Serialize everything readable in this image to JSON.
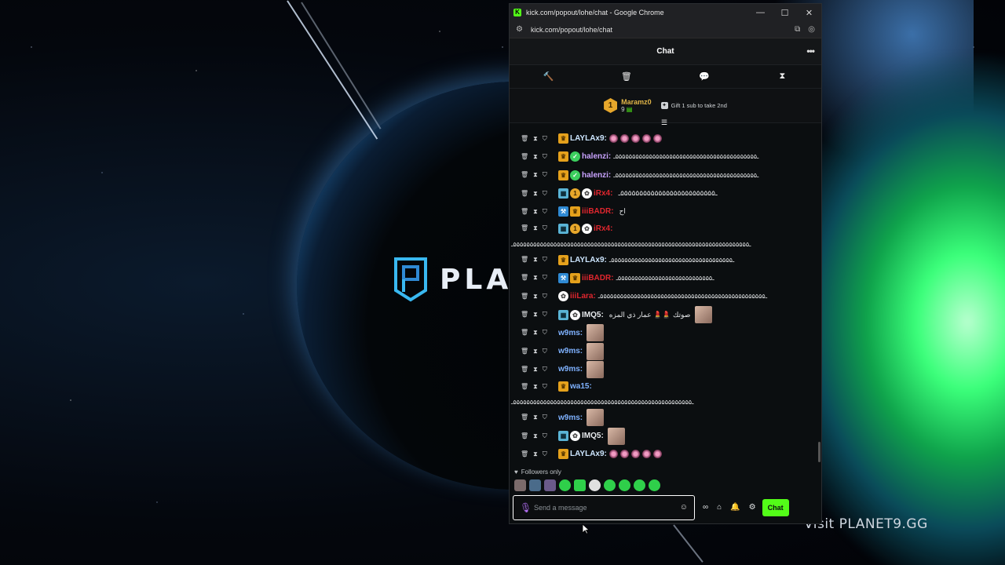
{
  "background": {
    "logo_text": "PLA",
    "visit_text": "Visit PLANET9.GG"
  },
  "window": {
    "title": "kick.com/popout/lohe/chat - Google Chrome",
    "url": "kick.com/popout/lohe/chat",
    "controls": {
      "minimize": "—",
      "maximize": "☐",
      "close": "✕"
    }
  },
  "chat": {
    "header_title": "Chat",
    "more_label": "•••",
    "modbar": {
      "ban": "🔨",
      "clear": "🗑",
      "chat_mode": "💬",
      "slow_mode": "⧗"
    },
    "pinned": {
      "rank": "1",
      "username": "Maramz0",
      "count": "9",
      "gift_text": "Gift 1 sub to take 2nd"
    },
    "messages": [
      {
        "user": "LAYLAx9",
        "color": "#cde6ff",
        "badges": [
          "crown"
        ],
        "text": "",
        "emotes": 5
      },
      {
        "user": "halenzi",
        "color": "#c9a3ff",
        "badges": [
          "crown",
          "verified"
        ],
        "text": "ـ۵۵۵۵۵۵۵۵۵۵۵۵۵۵۵۵۵۵۵۵۵۵۵۵۵۵۵۵۵۵۵۵۵۵۵۵۵۵۵۵۵۵ـ"
      },
      {
        "user": "halenzi",
        "color": "#c9a3ff",
        "badges": [
          "crown",
          "verified"
        ],
        "text": "ـ۵۵۵۵۵۵۵۵۵۵۵۵۵۵۵۵۵۵۵۵۵۵۵۵۵۵۵۵۵۵۵۵۵۵۵۵۵۵۵۵۵۵ـ"
      },
      {
        "user": "iRx4",
        "color": "#e0262e",
        "badges": [
          "blue",
          "one",
          "flower"
        ],
        "text": "ـ۵۵۵۵۵۵۵۵۵۵۵۵۵۵۵۵۵۵۵۵۵۵۵۵۵ـ"
      },
      {
        "user": "iiiBADR",
        "color": "#e0262e",
        "badges": [
          "tool",
          "crown"
        ],
        "text": "اح"
      },
      {
        "user": "iRx4",
        "color": "#e0262e",
        "badges": [
          "blue",
          "one",
          "flower"
        ],
        "text": "",
        "cont": "ـ۵۵۵۵۵۵۵۵۵۵۵۵۵۵۵۵۵۵۵۵۵۵۵۵۵۵۵۵۵۵۵۵۵۵۵۵۵۵۵۵۵۵۵۵۵۵۵۵۵۵۵۵۵۵۵۵۵۵۵۵۵۵۵۵۵۵۵۵۵۵ـ"
      },
      {
        "user": "LAYLAx9",
        "color": "#cde6ff",
        "badges": [
          "crown"
        ],
        "text": "ـ۵۵۵۵۵۵۵۵۵۵۵۵۵۵۵۵۵۵۵۵۵۵۵۵۵۵۵۵۵۵۵۵۵۵۵۵ـ"
      },
      {
        "user": "iiiBADR",
        "color": "#e0262e",
        "badges": [
          "tool",
          "crown"
        ],
        "text": "ـ۵۵۵۵۵۵۵۵۵۵۵۵۵۵۵۵۵۵۵۵۵۵۵۵۵۵۵۵ـ"
      },
      {
        "user": "iiiLara",
        "color": "#e0262e",
        "badges": [
          "flower"
        ],
        "text": "ـ۵۵۵۵۵۵۵۵۵۵۵۵۵۵۵۵۵۵۵۵۵۵۵۵۵۵۵۵۵۵۵۵۵۵۵۵۵۵۵۵۵۵۵۵۵۵۵۵۵ـ"
      },
      {
        "user": "IMQ5",
        "color": "#e9ecef",
        "badges": [
          "blue",
          "flower"
        ],
        "text": "صوتك 💄💄 عمار ذي المزه",
        "photo": true
      },
      {
        "user": "w9ms",
        "color": "#7fb2ff",
        "badges": [],
        "text": "",
        "photo": true
      },
      {
        "user": "w9ms",
        "color": "#7fb2ff",
        "badges": [],
        "text": "",
        "photo": true
      },
      {
        "user": "w9ms",
        "color": "#7fb2ff",
        "badges": [],
        "text": "",
        "photo": true
      },
      {
        "user": "wa15",
        "color": "#7fb2ff",
        "badges": [
          "crown"
        ],
        "text": "",
        "cont": "ـ۵۵۵۵۵۵۵۵۵۵۵۵۵۵۵۵۵۵۵۵۵۵۵۵۵۵۵۵۵۵۵۵۵۵۵۵۵۵۵۵۵۵۵۵۵۵۵۵۵۵۵۵۵ـ"
      },
      {
        "user": "w9ms",
        "color": "#7fb2ff",
        "badges": [],
        "text": "",
        "photo": true
      },
      {
        "user": "IMQ5",
        "color": "#e9ecef",
        "badges": [
          "blue",
          "flower"
        ],
        "text": "",
        "photo": true
      },
      {
        "user": "LAYLAx9",
        "color": "#cde6ff",
        "badges": [
          "crown"
        ],
        "text": "",
        "emotes": 5
      }
    ],
    "followers_only": "Followers only",
    "input": {
      "placeholder": "Send a message"
    },
    "send_label": "Chat"
  },
  "colors": {
    "kick_green": "#53fc18",
    "gold": "#e2b648",
    "panel": "#0b0e10"
  }
}
